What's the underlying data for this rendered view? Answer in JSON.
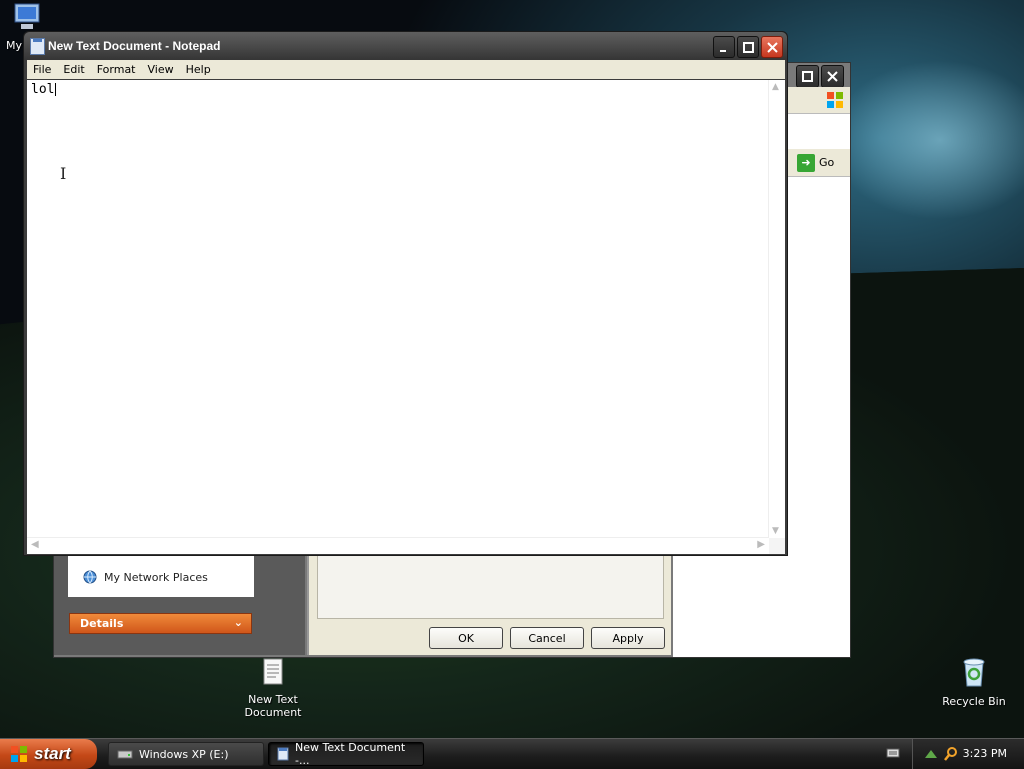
{
  "desktop": {
    "icons": {
      "my_computer": "My",
      "new_text_document_line1": "New Text",
      "new_text_document_line2": "Document",
      "recycle_bin": "Recycle Bin"
    }
  },
  "back_window": {
    "go_label": "Go",
    "places_item": "My Network Places",
    "details_label": "Details",
    "dialog_buttons": {
      "ok": "OK",
      "cancel": "Cancel",
      "apply": "Apply"
    }
  },
  "notepad": {
    "title": "New Text Document - Notepad",
    "menu": [
      "File",
      "Edit",
      "Format",
      "View",
      "Help"
    ],
    "content": "lol",
    "ibeam_glyph": "I"
  },
  "taskbar": {
    "start_label": "start",
    "tasks": [
      "Windows XP (E:)",
      "New Text Document -..."
    ],
    "clock": "3:23 PM"
  },
  "colors": {
    "start_orange": "#c44817",
    "details_orange": "#e0702a",
    "go_green": "#37a634",
    "close_red": "#c5371f"
  }
}
